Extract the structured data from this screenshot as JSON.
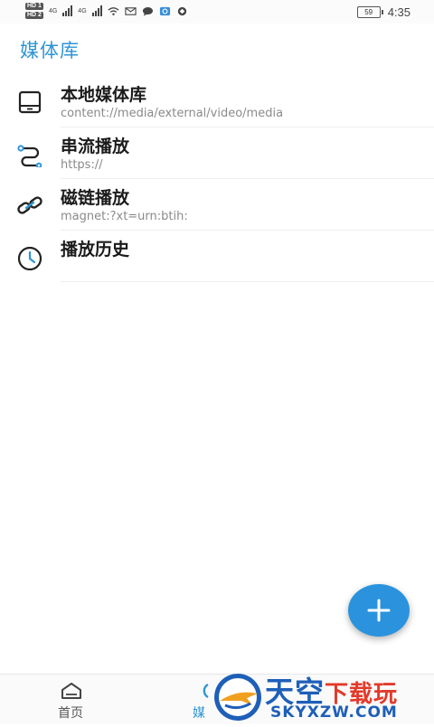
{
  "status_bar": {
    "sim1": "HD 1",
    "sim2": "HD 2",
    "net1": "4G",
    "net2": "4G",
    "battery": "59",
    "time": "4:35"
  },
  "header": {
    "title": "媒体库"
  },
  "list": [
    {
      "title": "本地媒体库",
      "subtitle": "content://media/external/video/media",
      "icon": "tablet-icon"
    },
    {
      "title": "串流播放",
      "subtitle": "https://",
      "icon": "stream-path-icon"
    },
    {
      "title": "磁链播放",
      "subtitle": "magnet:?xt=urn:btih:",
      "icon": "link-icon"
    },
    {
      "title": "播放历史",
      "subtitle": "",
      "icon": "clock-icon"
    }
  ],
  "fab": {
    "label": "+",
    "icon": "plus-icon"
  },
  "bottom_nav": {
    "home_label": "首页",
    "media_label": "媒"
  },
  "watermark": {
    "title_blue": "天空",
    "title_red": "下载玩",
    "url": "SKYXZW.COM"
  },
  "colors": {
    "accent": "#2f95d5",
    "fab": "#2b93dd",
    "icon_blue": "#2f95d5"
  }
}
